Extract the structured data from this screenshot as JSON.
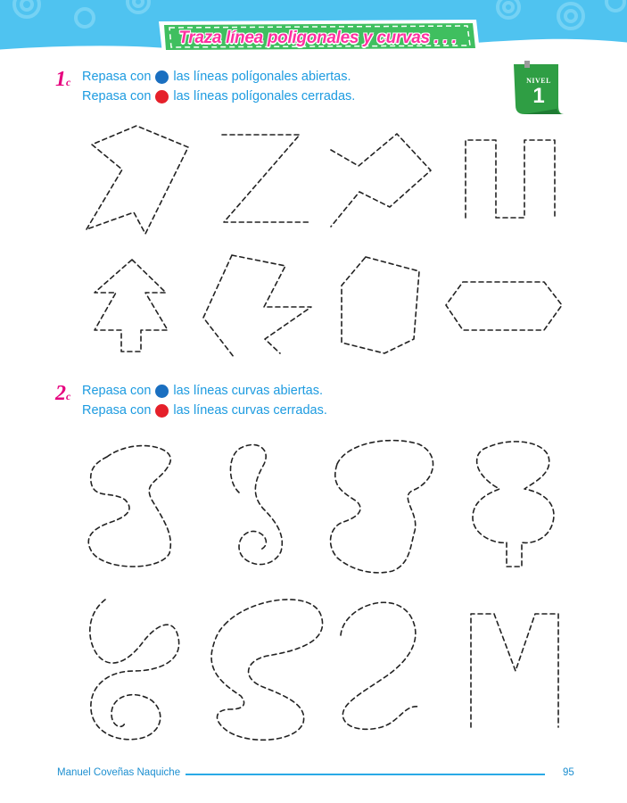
{
  "header": {
    "title": "Traza línea poligonales y curvas . . .",
    "level_label": "NIVEL",
    "level_number": "1"
  },
  "exercise1": {
    "number": "1",
    "suffix": "c",
    "line1_before": "Repasa con",
    "line1_after": "las líneas polígonales abiertas.",
    "line1_color": "#1a6fc0",
    "line2_before": "Repasa con",
    "line2_after": "las líneas polígonales cerradas.",
    "line2_color": "#e5202a"
  },
  "exercise2": {
    "number": "2",
    "suffix": "c",
    "line1_before": "Repasa con",
    "line1_after": "las líneas curvas abiertas.",
    "line1_color": "#1a6fc0",
    "line2_before": "Repasa con",
    "line2_after": "las líneas curvas cerradas.",
    "line2_color": "#e5202a"
  },
  "footer": {
    "author": "Manuel Coveñas Naquiche",
    "page": "95"
  },
  "colors": {
    "banner_blue": "#4fc3f0",
    "title_pink": "#ff2fa0",
    "title_box_green": "#3fbf5f",
    "text_blue": "#1d9be0",
    "accent_magenta": "#e6007e"
  }
}
